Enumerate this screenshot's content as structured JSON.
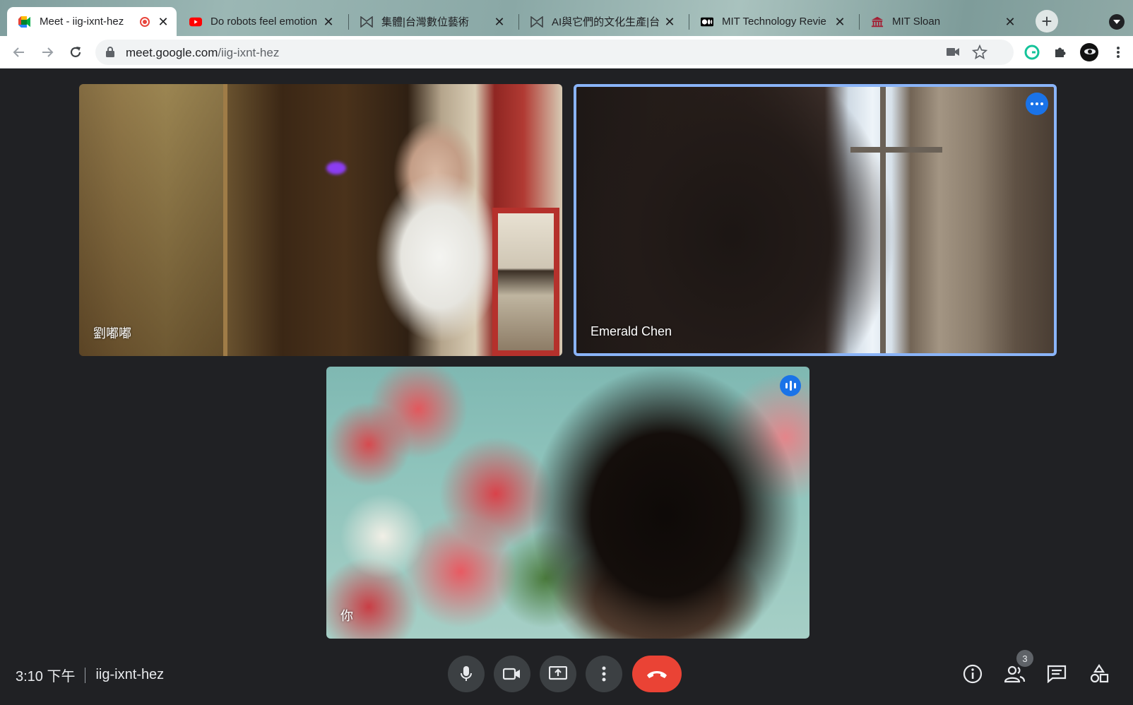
{
  "browser": {
    "tabs": [
      {
        "title": "Meet - iig-ixnt-hez",
        "favicon": "google-meet-icon",
        "recording": true,
        "active": true
      },
      {
        "title": "Do robots feel emotion",
        "favicon": "youtube-icon"
      },
      {
        "title": "集體|台灣數位藝術",
        "favicon": "bookmark-logo-icon"
      },
      {
        "title": "AI與它們的文化生產|台",
        "favicon": "bookmark-logo-icon"
      },
      {
        "title": "MIT Technology Revie",
        "favicon": "medium-icon"
      },
      {
        "title": "MIT Sloan",
        "favicon": "mit-building-icon"
      }
    ],
    "address": {
      "domain": "meet.google.com",
      "path": "/iig-ixnt-hez"
    }
  },
  "meet": {
    "participants": [
      {
        "name": "劉嘟嘟"
      },
      {
        "name": "Emerald Chen"
      },
      {
        "name": "你"
      }
    ],
    "time": "3:10 下午",
    "meeting_code": "iig-ixnt-hez",
    "participant_count": "3"
  },
  "colors": {
    "accent": "#1a73e8",
    "hangup": "#ea4335",
    "background": "#202124",
    "speaker_border": "#8ab4f8"
  }
}
